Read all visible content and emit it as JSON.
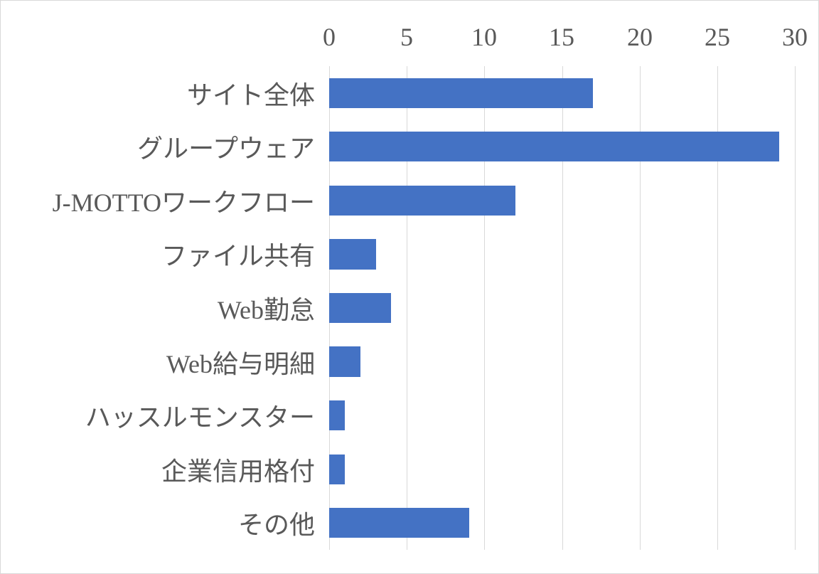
{
  "chart_data": {
    "type": "bar",
    "orientation": "horizontal",
    "categories": [
      "サイト全体",
      "グループウェア",
      "J-MOTTOワークフロー",
      "ファイル共有",
      "Web勤怠",
      "Web給与明細",
      "ハッスルモンスター",
      "企業信用格付",
      "その他"
    ],
    "values": [
      17,
      29,
      12,
      3,
      4,
      2,
      1,
      1,
      9
    ],
    "xlim": [
      0,
      30
    ],
    "xticks": [
      0,
      5,
      10,
      15,
      20,
      25,
      30
    ],
    "title": "",
    "xlabel": "",
    "ylabel": "",
    "bar_color": "#4472c4",
    "grid_color": "#d9d9d9",
    "label_color": "#595959"
  }
}
